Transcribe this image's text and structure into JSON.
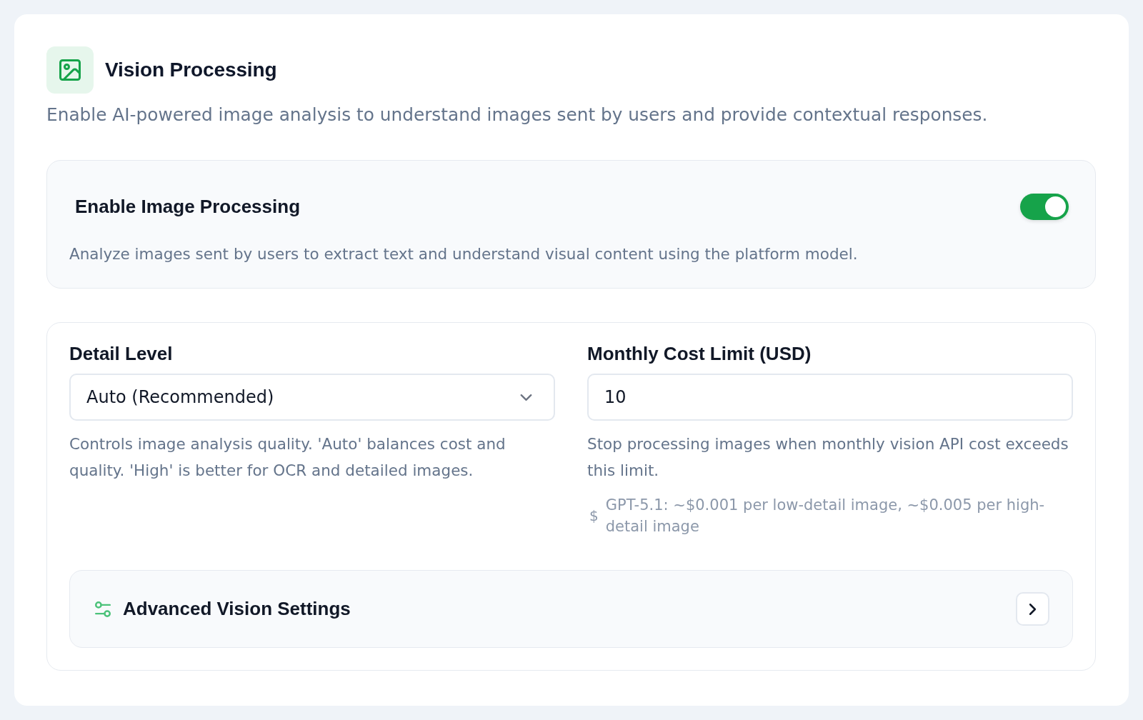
{
  "header": {
    "title": "Vision Processing",
    "description": "Enable AI-powered image analysis to understand images sent by users and provide contextual responses."
  },
  "enable_card": {
    "title": "Enable Image Processing",
    "on": true,
    "description": "Analyze images sent by users to extract text and understand visual content using the platform model."
  },
  "settings": {
    "detail_level": {
      "label": "Detail Level",
      "value": "Auto (Recommended)",
      "help": "Controls image analysis quality. 'Auto' balances cost and quality. 'High' is better for OCR and detailed images."
    },
    "monthly_cost_limit": {
      "label": "Monthly Cost Limit (USD)",
      "value": "10",
      "help": "Stop processing images when monthly vision API cost exceeds this limit.",
      "note_symbol": "$",
      "note": "GPT-5.1: ~$0.001 per low-detail image, ~$0.005 per high-detail image"
    }
  },
  "advanced": {
    "title": "Advanced Vision Settings",
    "expanded": false
  }
}
